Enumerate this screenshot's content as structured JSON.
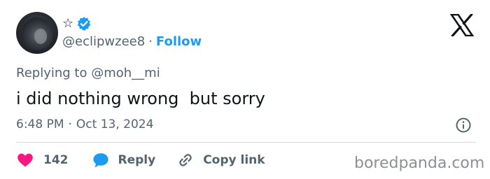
{
  "author": {
    "display_name": "☆",
    "handle": "@eclipwzee8",
    "separator": "·",
    "follow_label": "Follow"
  },
  "icons": {
    "verified": "verified-badge-icon",
    "platform": "x-logo-icon",
    "info": "info-icon",
    "like": "heart-icon",
    "reply": "speech-bubble-icon",
    "copy": "link-icon"
  },
  "tweet": {
    "replying_to": "Replying to @moh__mi",
    "text": "i did nothing wrong  but sorry",
    "time": "6:48 PM",
    "dot": "·",
    "date": "Oct 13, 2024"
  },
  "actions": {
    "like_count": "142",
    "reply_label": "Reply",
    "copy_label": "Copy link"
  },
  "watermark": "boredpanda.com",
  "colors": {
    "text": "#0f1419",
    "secondary": "#536471",
    "accent": "#1d9bf0",
    "like": "#f91880",
    "divider": "#cfd9de",
    "watermark": "#8d8f93"
  }
}
